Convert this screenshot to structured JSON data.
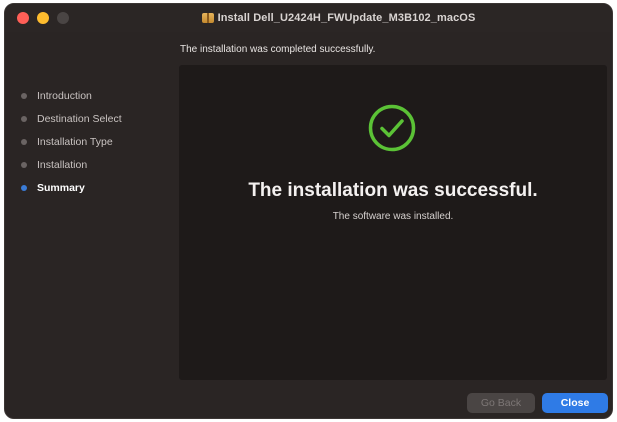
{
  "window": {
    "title": "Install Dell_U2424H_FWUpdate_M3B102_macOS",
    "icon": "package-icon"
  },
  "header": {
    "subtitle": "The installation was completed successfully."
  },
  "sidebar": {
    "items": [
      {
        "label": "Introduction",
        "active": false
      },
      {
        "label": "Destination Select",
        "active": false
      },
      {
        "label": "Installation Type",
        "active": false
      },
      {
        "label": "Installation",
        "active": false
      },
      {
        "label": "Summary",
        "active": true
      }
    ]
  },
  "main": {
    "icon": "checkmark-circle-icon",
    "headline": "The installation was successful.",
    "message": "The software was installed."
  },
  "buttons": {
    "back_label": "Go Back",
    "close_label": "Close"
  },
  "colors": {
    "accent": "#2f7be6",
    "success": "#5bc236",
    "background": "#2a2524"
  }
}
